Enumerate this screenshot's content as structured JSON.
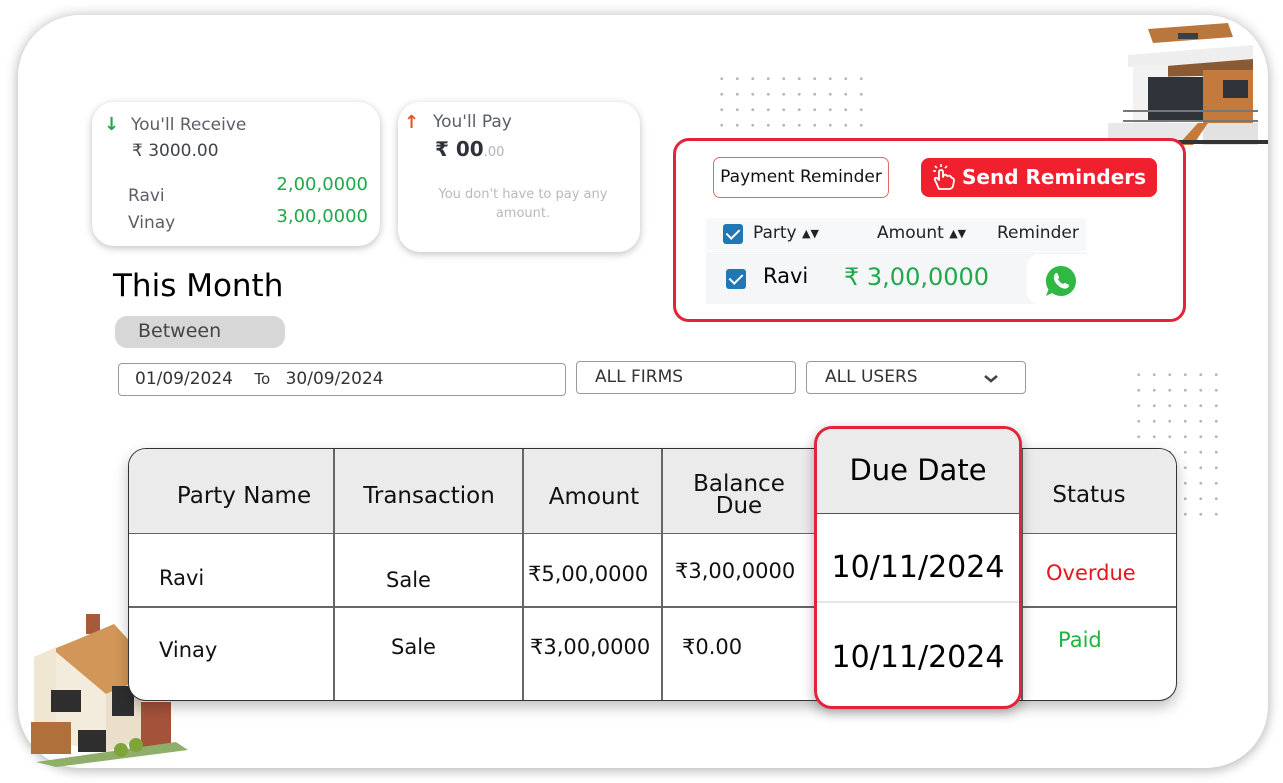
{
  "receive_card": {
    "icon": "arrow-down-icon",
    "title": "You'll Receive",
    "total": "₹ 3000.00",
    "rows": [
      {
        "name": "Ravi",
        "value": "2,00,0000"
      },
      {
        "name": "Vinay",
        "value": "3,00,0000"
      }
    ]
  },
  "pay_card": {
    "icon": "arrow-up-icon",
    "title": "You'll Pay",
    "total_main": "₹ 00",
    "total_decimal": ".00",
    "message": "You don't have to pay any amount."
  },
  "reminder_panel": {
    "payment_reminder_label": "Payment Reminder",
    "send_reminders_label": "Send Reminders",
    "columns": [
      "Party",
      "Amount",
      "Reminder"
    ],
    "row": {
      "party": "Ravi",
      "amount": "₹ 3,00,0000",
      "icon": "whatsapp-icon"
    }
  },
  "filters": {
    "heading": "This Month",
    "range_label": "Between",
    "from_date": "01/09/2024",
    "to_label": "To",
    "to_date": "30/09/2024",
    "firm_select": "ALL FIRMS",
    "user_select": "ALL USERS"
  },
  "table": {
    "headers": {
      "party": "Party Name",
      "transaction": "Transaction",
      "amount": "Amount",
      "balance_line1": "Balance",
      "balance_line2": "Due",
      "due_date": "Due Date",
      "status": "Status"
    },
    "rows": [
      {
        "party": "Ravi",
        "transaction": "Sale",
        "amount": "₹5,00,0000",
        "balance": "₹3,00,0000",
        "due_date": "10/11/2024",
        "status": "Overdue"
      },
      {
        "party": "Vinay",
        "transaction": "Sale",
        "amount": "₹3,00,0000",
        "balance": "₹0.00",
        "due_date": "10/11/2024",
        "status": "Paid"
      }
    ]
  },
  "colors": {
    "accent_red": "#e2233a",
    "send_button": "#f0202f",
    "positive_green": "#1fa94a",
    "overdue_red": "#e8141e",
    "paid_green": "#22b33a",
    "checkbox_blue": "#1f77b4"
  }
}
